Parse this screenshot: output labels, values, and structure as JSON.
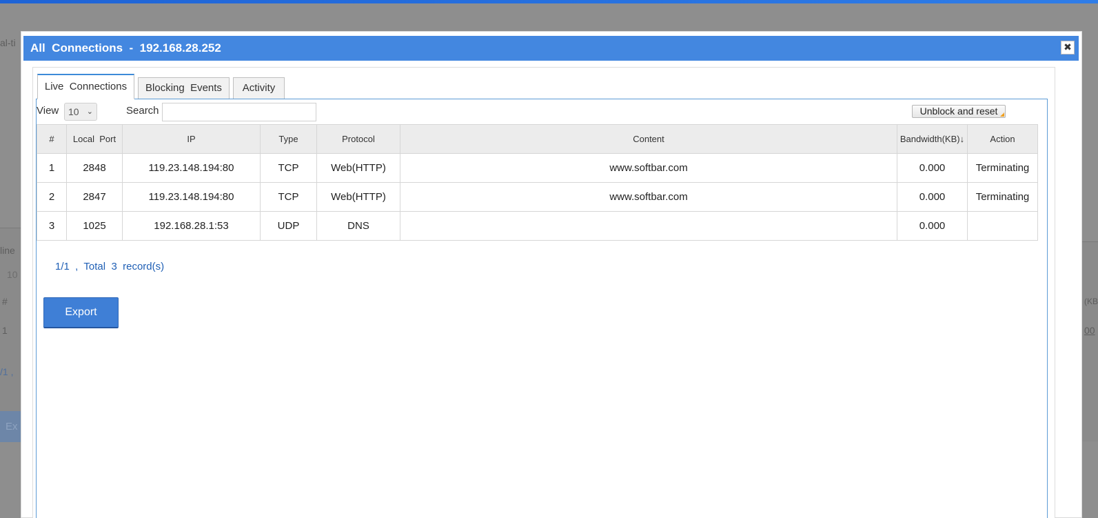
{
  "background": {
    "labels": [
      "al-ti",
      "line",
      "10",
      "#",
      "1",
      "/1  ,",
      "Ex",
      "(KB)↓",
      "00"
    ]
  },
  "dialog": {
    "title": "All  Connections  -  192.168.28.252",
    "close_glyph": "✖"
  },
  "tabs": [
    {
      "label": "Live  Connections",
      "active": true
    },
    {
      "label": "Blocking  Events",
      "active": false
    },
    {
      "label": "Activity",
      "active": false
    }
  ],
  "toolbar": {
    "view_label": "View",
    "view_value": "10",
    "search_label": "Search",
    "search_value": "",
    "unblock_label": "Unblock and reset"
  },
  "table": {
    "columns": [
      "#",
      "Local  Port",
      "IP",
      "Type",
      "Protocol",
      "Content",
      "Bandwidth(KB)↓",
      "Action"
    ],
    "rows": [
      {
        "num": "1",
        "port": "2848",
        "ip": "119.23.148.194:80",
        "type": "TCP",
        "protocol": "Web(HTTP)",
        "content": "www.softbar.com",
        "bandwidth": "0.000",
        "action": "Terminating"
      },
      {
        "num": "2",
        "port": "2847",
        "ip": "119.23.148.194:80",
        "type": "TCP",
        "protocol": "Web(HTTP)",
        "content": "www.softbar.com",
        "bandwidth": "0.000",
        "action": "Terminating"
      },
      {
        "num": "3",
        "port": "1025",
        "ip": "192.168.28.1:53",
        "type": "UDP",
        "protocol": "DNS",
        "content": "",
        "bandwidth": "0.000",
        "action": ""
      }
    ]
  },
  "pager": "1/1  ,  Total  3  record(s)",
  "export_label": "Export",
  "colors": {
    "titlebar": "#4387e0",
    "active_tab_border": "#3d8ad8",
    "pager_text": "#1f5fb5",
    "export_button": "#3f7fd6"
  }
}
